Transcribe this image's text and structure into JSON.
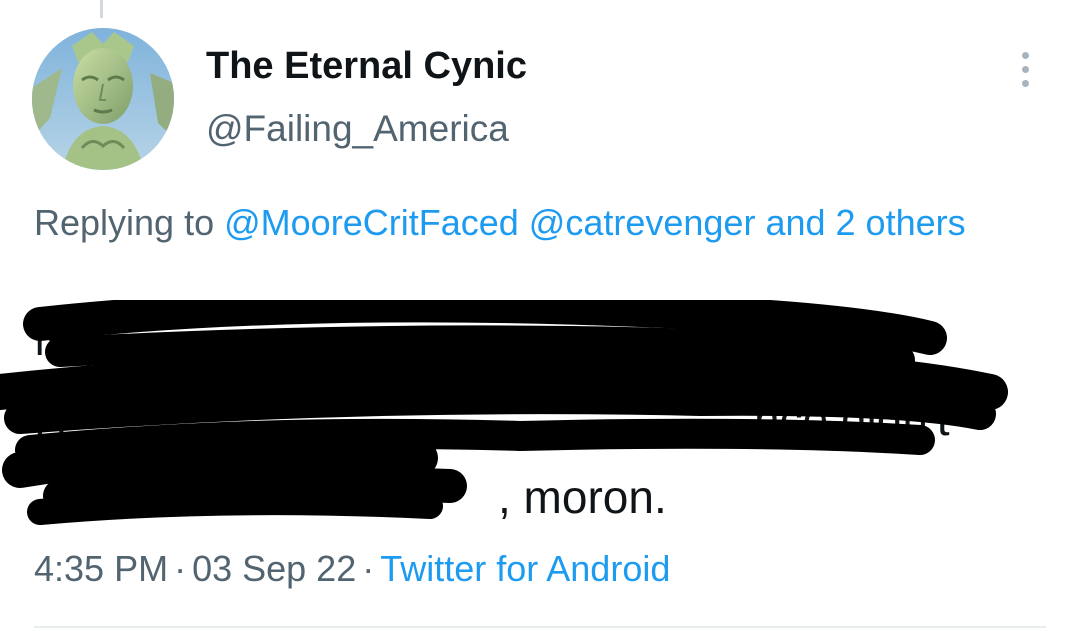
{
  "author": {
    "display_name": "The Eternal Cynic",
    "handle": "@Failing_America",
    "avatar_icon": "statue-of-liberty-avatar"
  },
  "reply": {
    "prefix": "Replying to",
    "mention_1": "@MooreCritFaced",
    "mention_2": "@catrevenger",
    "others": "and 2 others"
  },
  "tweet": {
    "line_1": "N",
    "line_2": "H",
    "line_2_visible_end": "nce didn't",
    "tail": ", moron.",
    "redacted": true
  },
  "meta": {
    "time": "4:35 PM",
    "separator": "·",
    "date": "03 Sep 22",
    "source": "Twitter for Android"
  },
  "colors": {
    "link": "#1d9bf0",
    "secondary_text": "#536471",
    "primary_text": "#0f1419",
    "redaction": "#000000"
  }
}
